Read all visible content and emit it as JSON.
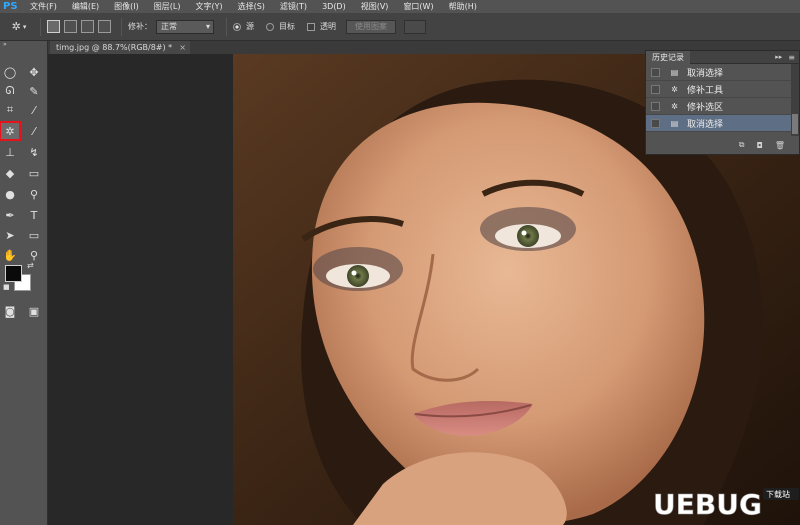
{
  "app": {
    "logo": "PS"
  },
  "menu": [
    {
      "id": "file",
      "label": "文件(F)"
    },
    {
      "id": "edit",
      "label": "编辑(E)"
    },
    {
      "id": "image",
      "label": "图像(I)"
    },
    {
      "id": "layer",
      "label": "图层(L)"
    },
    {
      "id": "type",
      "label": "文字(Y)"
    },
    {
      "id": "select",
      "label": "选择(S)"
    },
    {
      "id": "filter",
      "label": "滤镜(T)"
    },
    {
      "id": "3d",
      "label": "3D(D)"
    },
    {
      "id": "view",
      "label": "视图(V)"
    },
    {
      "id": "window",
      "label": "窗口(W)"
    },
    {
      "id": "help",
      "label": "帮助(H)"
    }
  ],
  "options": {
    "patch_label": "修补：",
    "patch_mode": "正常",
    "source_label": "源",
    "destination_label": "目标",
    "transparent_label": "透明",
    "use_pattern_label": "使用图案"
  },
  "document": {
    "tab_label": "timg.jpg @ 88.7%(RGB/8#) *",
    "close_glyph": "×"
  },
  "history": {
    "title": "历史记录",
    "items": [
      {
        "label": "取消选择",
        "icon": "document-icon",
        "selected": false
      },
      {
        "label": "修补工具",
        "icon": "patch-tool-icon",
        "selected": false
      },
      {
        "label": "修补选区",
        "icon": "patch-tool-icon",
        "selected": false
      },
      {
        "label": "取消选择",
        "icon": "document-icon",
        "selected": true
      }
    ]
  },
  "watermark": {
    "text": "UEBUG",
    "badge": "下载站"
  },
  "colors": {
    "accent_highlight": "#e8121c",
    "history_selected": "#5e6e84",
    "foreground": "#000000",
    "background": "#ffffff"
  }
}
